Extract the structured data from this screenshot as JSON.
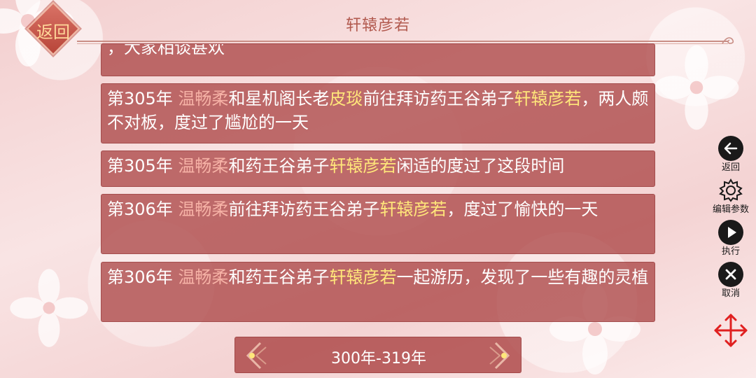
{
  "header": {
    "title": "轩辕彦若",
    "back_label": "返回"
  },
  "events": [
    {
      "segments": [
        {
          "text": "，大家相谈甚欢",
          "style": "plain"
        }
      ]
    },
    {
      "segments": [
        {
          "text": "第305年 ",
          "style": "plain"
        },
        {
          "text": "温畅柔",
          "style": "pink"
        },
        {
          "text": "和星机阁长老",
          "style": "plain"
        },
        {
          "text": "皮琰",
          "style": "yellow"
        },
        {
          "text": "前往拜访药王谷弟子",
          "style": "plain"
        },
        {
          "text": "轩辕彦若",
          "style": "yellow"
        },
        {
          "text": "，两人颇不对板，度过了尴尬的一天",
          "style": "plain"
        }
      ]
    },
    {
      "segments": [
        {
          "text": "第305年 ",
          "style": "plain"
        },
        {
          "text": "温畅柔",
          "style": "pink"
        },
        {
          "text": "和药王谷弟子",
          "style": "plain"
        },
        {
          "text": "轩辕彦若",
          "style": "yellow"
        },
        {
          "text": "闲适的度过了这段时间",
          "style": "plain"
        }
      ]
    },
    {
      "segments": [
        {
          "text": "第306年 ",
          "style": "plain"
        },
        {
          "text": "温畅柔",
          "style": "pink"
        },
        {
          "text": "前往拜访药王谷弟子",
          "style": "plain"
        },
        {
          "text": "轩辕彦若",
          "style": "yellow"
        },
        {
          "text": "，度过了愉快的一天",
          "style": "plain"
        }
      ]
    },
    {
      "segments": [
        {
          "text": "第306年 ",
          "style": "plain"
        },
        {
          "text": "温畅柔",
          "style": "pink"
        },
        {
          "text": "和药王谷弟子",
          "style": "plain"
        },
        {
          "text": "轩辕彦若",
          "style": "yellow"
        },
        {
          "text": "一起游历，发现了一些有趣的灵植",
          "style": "plain"
        }
      ]
    }
  ],
  "range_nav": {
    "label": "300年-319年"
  },
  "side_controls": [
    {
      "id": "back",
      "label": "返回",
      "icon": "arrow-left-icon"
    },
    {
      "id": "edit-params",
      "label": "编辑参数",
      "icon": "gear-icon"
    },
    {
      "id": "execute",
      "label": "执行",
      "icon": "play-icon"
    },
    {
      "id": "cancel",
      "label": "取消",
      "icon": "close-icon"
    }
  ],
  "colors": {
    "panel": "#ac4646",
    "name_pink": "#f6b2a6",
    "name_yellow": "#ffe67a",
    "move_handle": "#e02020"
  }
}
